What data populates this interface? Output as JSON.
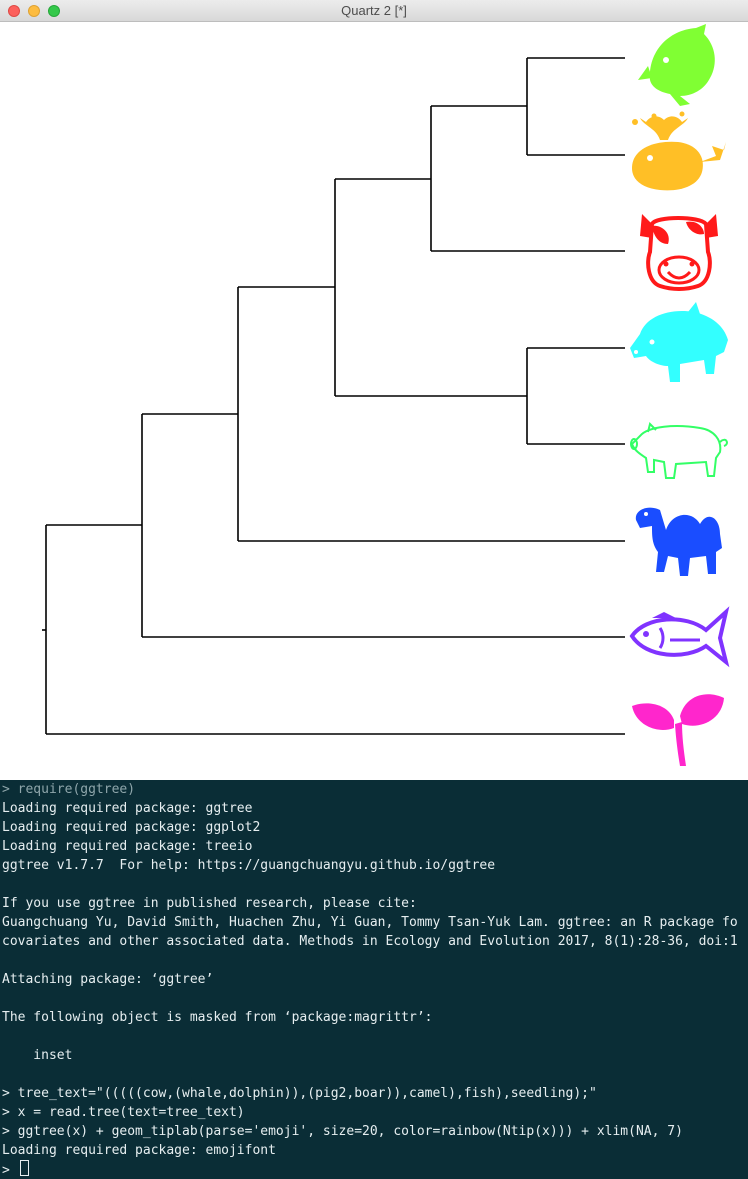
{
  "window": {
    "title": "Quartz 2 [*]"
  },
  "tree": {
    "tips": [
      {
        "label": "dolphin",
        "icon": "dolphin-icon",
        "color": "#80ff33"
      },
      {
        "label": "whale",
        "icon": "whale-icon",
        "color": "#ffbf26"
      },
      {
        "label": "cow",
        "icon": "cow-icon",
        "color": "#ff1a1a"
      },
      {
        "label": "boar",
        "icon": "boar-icon",
        "color": "#33ffff"
      },
      {
        "label": "pig2",
        "icon": "pig-icon",
        "color": "#33ff66"
      },
      {
        "label": "camel",
        "icon": "camel-icon",
        "color": "#1a4dff"
      },
      {
        "label": "fish",
        "icon": "fish-icon",
        "color": "#8033ff"
      },
      {
        "label": "seedling",
        "icon": "seedling-icon",
        "color": "#ff26cc"
      }
    ]
  },
  "console": {
    "lines": [
      "> require(ggtree)",
      "Loading required package: ggtree",
      "Loading required package: ggplot2",
      "Loading required package: treeio",
      "ggtree v1.7.7  For help: https://guangchuangyu.github.io/ggtree",
      "",
      "If you use ggtree in published research, please cite:",
      "Guangchuang Yu, David Smith, Huachen Zhu, Yi Guan, Tommy Tsan-Yuk Lam. ggtree: an R package fo",
      "covariates and other associated data. Methods in Ecology and Evolution 2017, 8(1):28-36, doi:1",
      "",
      "Attaching package: ‘ggtree’",
      "",
      "The following object is masked from ‘package:magrittr’:",
      "",
      "    inset",
      "",
      "> tree_text=\"(((((cow,(whale,dolphin)),(pig2,boar)),camel),fish),seedling);\"",
      "> x = read.tree(text=tree_text)",
      "> ggtree(x) + geom_tiplab(parse='emoji', size=20, color=rainbow(Ntip(x))) + xlim(NA, 7)",
      "Loading required package: emojifont"
    ],
    "prompt": ">"
  }
}
